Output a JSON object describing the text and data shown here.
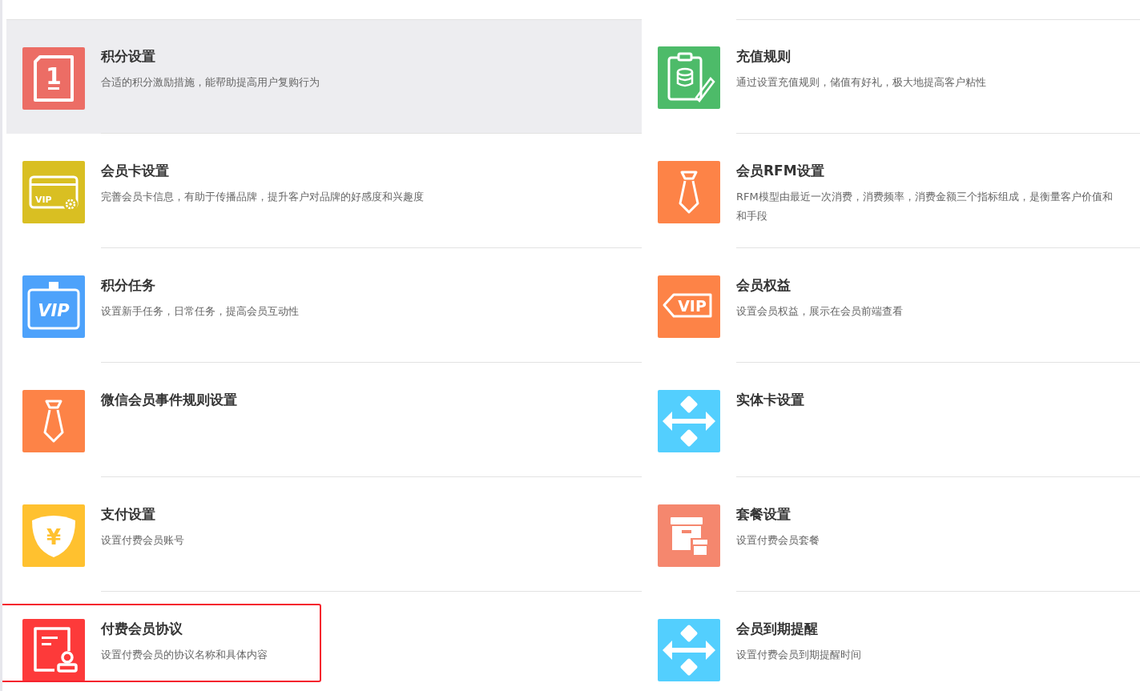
{
  "settings": [
    {
      "title": "积分设置",
      "description_lines": [
        "合适的积分激励措施，能帮助提高用户复购行为"
      ],
      "icon": {
        "kind": "number-card",
        "color": "#ec6d65",
        "glyph": "1"
      },
      "hovered": true,
      "highlighted": false
    },
    {
      "title": "充值规则",
      "description_lines": [
        "通过设置充值规则，储值有好礼，极大地提高客户粘性"
      ],
      "icon": {
        "kind": "clipboard",
        "color": "#4dbb69"
      },
      "hovered": false,
      "highlighted": false
    },
    {
      "title": "会员卡设置",
      "description_lines": [
        "完善会员卡信息，有助于传播品牌，提升客户对品牌的好感度和兴趣度"
      ],
      "icon": {
        "kind": "vip-card",
        "color": "#d9bf22",
        "glyph": "VIP"
      },
      "hovered": false,
      "highlighted": false
    },
    {
      "title": "会员RFM设置",
      "description_lines": [
        "RFM模型由最近一次消费，消费频率，消费金额三个指标组成，是衡量客户价值和",
        "和手段"
      ],
      "icon": {
        "kind": "tie",
        "color": "#fd8347"
      },
      "hovered": false,
      "highlighted": false
    },
    {
      "title": "积分任务",
      "description_lines": [
        "设置新手任务，日常任务，提高会员互动性"
      ],
      "icon": {
        "kind": "vip-badge",
        "color": "#4da2fb",
        "glyph": "VIP"
      },
      "hovered": false,
      "highlighted": false
    },
    {
      "title": "会员权益",
      "description_lines": [
        "设置会员权益，展示在会员前端查看"
      ],
      "icon": {
        "kind": "vip-tag",
        "color": "#fd8347",
        "glyph": "VIP"
      },
      "hovered": false,
      "highlighted": false
    },
    {
      "title": "微信会员事件规则设置",
      "icon": {
        "kind": "tie",
        "color": "#fd8347"
      },
      "hovered": false,
      "highlighted": false
    },
    {
      "title": "实体卡设置",
      "icon": {
        "kind": "move-arrows",
        "color": "#53cffe"
      },
      "hovered": false,
      "highlighted": false
    },
    {
      "title": "支付设置",
      "description_lines": [
        "设置付费会员账号"
      ],
      "icon": {
        "kind": "shield-yen",
        "color": "#ffc12f",
        "glyph": "¥"
      },
      "hovered": false,
      "highlighted": false
    },
    {
      "title": "套餐设置",
      "description_lines": [
        "设置付费会员套餐"
      ],
      "icon": {
        "kind": "boxes",
        "color": "#f5876e"
      },
      "hovered": false,
      "highlighted": false
    },
    {
      "title": "付费会员协议",
      "description_lines": [
        "设置付费会员的协议名称和具体内容"
      ],
      "icon": {
        "kind": "agreement",
        "color": "#fd3a3a"
      },
      "hovered": false,
      "highlighted": true
    },
    {
      "title": "会员到期提醒",
      "description_lines": [
        "设置付费会员到期提醒时间"
      ],
      "icon": {
        "kind": "move-arrows",
        "color": "#53cffe"
      },
      "hovered": false,
      "highlighted": false
    }
  ]
}
